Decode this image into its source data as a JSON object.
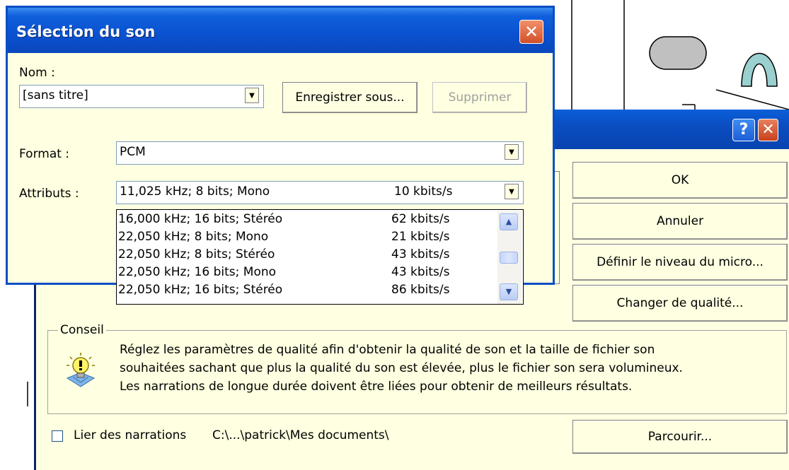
{
  "front_dialog": {
    "title": "Sélection du son",
    "close_glyph": "✕",
    "name_label": "Nom :",
    "name_value": "[sans titre]",
    "save_as_label": "Enregistrer sous...",
    "delete_label": "Supprimer",
    "format_label": "Format :",
    "format_value": "PCM",
    "attributes_label": "Attributs :",
    "attributes_value": {
      "name": "11,025 kHz; 8 bits; Mono",
      "rate": "10 kbits/s"
    },
    "attributes_options": [
      {
        "name": "16,000 kHz; 16 bits; Stéréo",
        "rate": "62 kbits/s"
      },
      {
        "name": "22,050 kHz; 8 bits; Mono",
        "rate": "21 kbits/s"
      },
      {
        "name": "22,050 kHz; 8 bits; Stéréo",
        "rate": "43 kbits/s"
      },
      {
        "name": "22,050 kHz; 16 bits; Mono",
        "rate": "43 kbits/s"
      },
      {
        "name": "22,050 kHz; 16 bits; Stéréo",
        "rate": "86 kbits/s"
      }
    ],
    "dropdown_icon": "chevron-down-icon",
    "scroll_up_glyph": "▲",
    "scroll_down_glyph": "▼"
  },
  "back_dialog": {
    "help_glyph": "?",
    "close_glyph": "✕",
    "ok_label": "OK",
    "cancel_label": "Annuler",
    "mic_level_label": "Définir le niveau du micro...",
    "quality_label": "Changer de qualité...",
    "tip_group_label": "Conseil",
    "tip_lines": [
      "Réglez les paramètres de qualité afin d'obtenir la qualité de son et la taille de fichier son",
      "souhaitées sachant que plus la qualité du son est élevée, plus le fichier son sera volumineux.",
      "Les narrations de longue durée doivent être liées pour obtenir de meilleurs résultats."
    ],
    "tip_icon": "lightbulb-icon",
    "link_narrations_label": "Lier des narrations",
    "link_narrations_checked": false,
    "path": "C:\\...\\patrick\\Mes documents\\",
    "browse_label": "Parcourir..."
  },
  "colors": {
    "dialog_bg": "#FFFFE1",
    "titlebar_blue": "#0A51CF",
    "close_red": "#D2502A"
  }
}
